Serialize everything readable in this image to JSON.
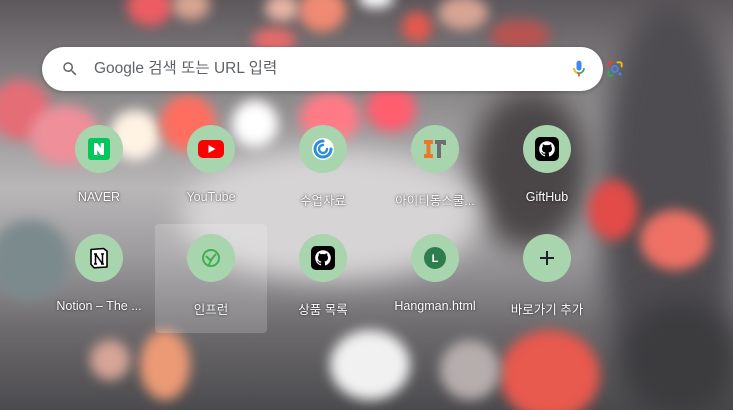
{
  "search": {
    "placeholder": "Google 검색 또는 URL 입력",
    "search_icon": "search-icon",
    "voice_icon": "microphone-icon",
    "lens_icon": "google-lens-icon"
  },
  "shortcuts": [
    {
      "label": "NAVER",
      "icon": "naver-icon",
      "color": "#03c75a"
    },
    {
      "label": "YouTube",
      "icon": "youtube-icon",
      "color": "#ff0000"
    },
    {
      "label": "수업자료",
      "icon": "onedrive-swirl-icon",
      "color": "#2f8fd6"
    },
    {
      "label": "아이티동스쿨...",
      "icon": "itd-logo-icon",
      "color": "#e8792a"
    },
    {
      "label": "GiftHub",
      "icon": "github-icon",
      "color": "#000000"
    },
    {
      "label": "Notion – The ...",
      "icon": "notion-icon",
      "color": "#000000"
    },
    {
      "label": "인프런",
      "icon": "inflearn-icon",
      "color": "#3fb04f"
    },
    {
      "label": "상품 목록",
      "icon": "github-icon",
      "color": "#000000"
    },
    {
      "label": "Hangman.html",
      "icon": "letter-l-icon",
      "letter": "L",
      "color": "#2e7d4f"
    },
    {
      "label": "바로가기 추가",
      "icon": "plus-icon"
    }
  ],
  "colors": {
    "tile_circle": "#a8d4ae",
    "search_bg": "#ffffff"
  }
}
